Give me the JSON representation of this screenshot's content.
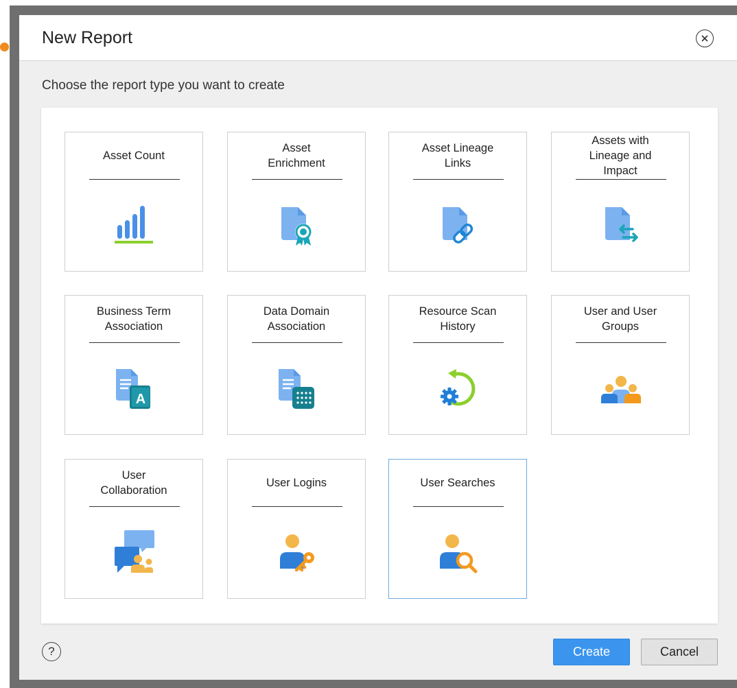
{
  "dialog": {
    "title": "New Report",
    "subtitle": "Choose the report type you want to create",
    "help_label": "?"
  },
  "report_types": [
    {
      "label": "Asset Count",
      "icon": "bar-chart-icon"
    },
    {
      "label": "Asset\nEnrichment",
      "icon": "document-badge-icon"
    },
    {
      "label": "Asset Lineage\nLinks",
      "icon": "document-link-icon"
    },
    {
      "label": "Assets with\nLineage and\nImpact",
      "icon": "document-arrows-icon"
    },
    {
      "label": "Business Term\nAssociation",
      "icon": "document-book-icon"
    },
    {
      "label": "Data Domain\nAssociation",
      "icon": "document-grid-icon"
    },
    {
      "label": "Resource Scan\nHistory",
      "icon": "gear-history-icon"
    },
    {
      "label": "User and User\nGroups",
      "icon": "user-group-icon"
    },
    {
      "label": "User\nCollaboration",
      "icon": "chat-users-icon"
    },
    {
      "label": "User Logins",
      "icon": "user-key-icon"
    },
    {
      "label": "User Searches",
      "icon": "user-search-icon"
    }
  ],
  "selected_index": 10,
  "footer": {
    "create_label": "Create",
    "cancel_label": "Cancel"
  },
  "colors": {
    "accent": "#3b95ee",
    "icon_blue": "#4a8fe8",
    "icon_light_blue": "#7cb2f0",
    "icon_orange": "#f39a1e",
    "icon_teal": "#1aa5b8",
    "icon_green": "#8ccf2e",
    "icon_yellow": "#f2b64a"
  }
}
